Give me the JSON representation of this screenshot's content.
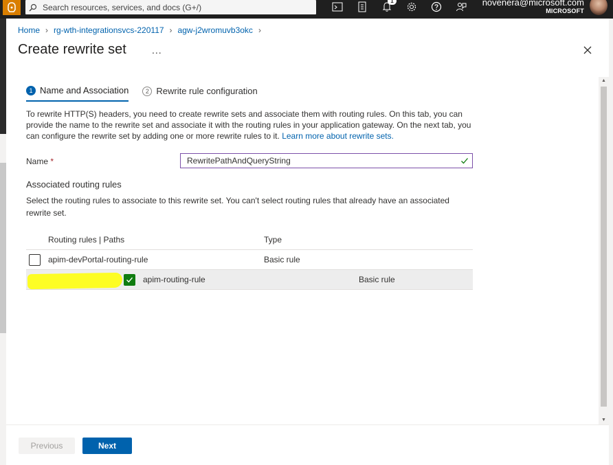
{
  "topbar": {
    "search_placeholder": "Search resources, services, and docs (G+/)",
    "notification_count": "1",
    "user_email": "novenera@microsoft.com",
    "user_tenant": "MICROSOFT"
  },
  "breadcrumb": {
    "items": [
      "Home",
      "rg-wth-integrationsvcs-220117",
      "agw-j2wromuvb3okc"
    ]
  },
  "page": {
    "title": "Create rewrite set",
    "more_label": "..."
  },
  "tabs": [
    {
      "number": "1",
      "label": "Name and Association"
    },
    {
      "number": "2",
      "label": "Rewrite rule configuration"
    }
  ],
  "description": {
    "text": "To rewrite HTTP(S) headers, you need to create rewrite sets and associate them with routing rules. On this tab, you can provide the name to the rewrite set and associate it with the routing rules in your application gateway. On the next tab, you can configure the rewrite set by adding one or more rewrite rules to it.",
    "link": "Learn more about rewrite sets."
  },
  "form": {
    "name_label": "Name",
    "required_marker": "*",
    "name_value": "RewritePathAndQueryString"
  },
  "routing": {
    "section_title": "Associated routing rules",
    "section_desc": "Select the routing rules to associate to this rewrite set. You can't select routing rules that already have an associated rewrite set.",
    "columns": [
      "Routing rules | Paths",
      "Type"
    ],
    "rows": [
      {
        "name": "apim-devPortal-routing-rule",
        "type": "Basic rule",
        "checked": false
      },
      {
        "name": "apim-routing-rule",
        "type": "Basic rule",
        "checked": true
      }
    ]
  },
  "footer": {
    "previous_label": "Previous",
    "next_label": "Next"
  },
  "colors": {
    "accent": "#0062ad",
    "check": "#107c10",
    "highlight": "#ffff00",
    "topbar": "#1f1f1f",
    "portal_logo": "#d97e00"
  }
}
